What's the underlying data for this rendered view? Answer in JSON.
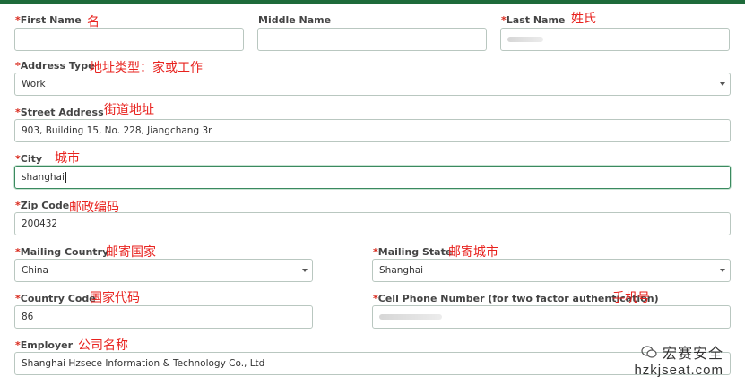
{
  "required_mark": "*",
  "fields": {
    "first_name": {
      "label": "First Name",
      "annotation": "名",
      "value": ""
    },
    "middle_name": {
      "label": "Middle Name",
      "value": ""
    },
    "last_name": {
      "label": "Last Name",
      "annotation": "姓氏",
      "value": ""
    },
    "address_type": {
      "label": "Address Type",
      "annotation": "地址类型：家或工作",
      "value": "Work"
    },
    "street_address": {
      "label": "Street Address",
      "annotation": "街道地址",
      "value": "903, Building 15, No. 228, Jiangchang 3r"
    },
    "city": {
      "label": "City",
      "annotation": "城市",
      "value": "shanghai"
    },
    "zip_code": {
      "label": "Zip Code",
      "annotation": "邮政编码",
      "value": "200432"
    },
    "mailing_country": {
      "label": "Mailing Country",
      "annotation": "邮寄国家",
      "value": "China"
    },
    "mailing_state": {
      "label": "Mailing State",
      "annotation": "邮寄城市",
      "value": "Shanghai"
    },
    "country_code": {
      "label": "Country Code",
      "annotation": "国家代码",
      "value": "86"
    },
    "cell_phone": {
      "label": "Cell Phone Number (for two factor authentication)",
      "annotation": "手机号",
      "value": ""
    },
    "employer": {
      "label": "Employer",
      "annotation": "公司名称",
      "value": "Shanghai Hzsece Information & Technology Co., Ltd"
    }
  },
  "watermark": {
    "brand": "宏赛安全",
    "site": "hzkjseat.com"
  },
  "colors": {
    "required": "#d9291c",
    "annotation": "#e8221e",
    "top_bar": "#1e6b3a",
    "active_border": "#3a8a5f"
  }
}
